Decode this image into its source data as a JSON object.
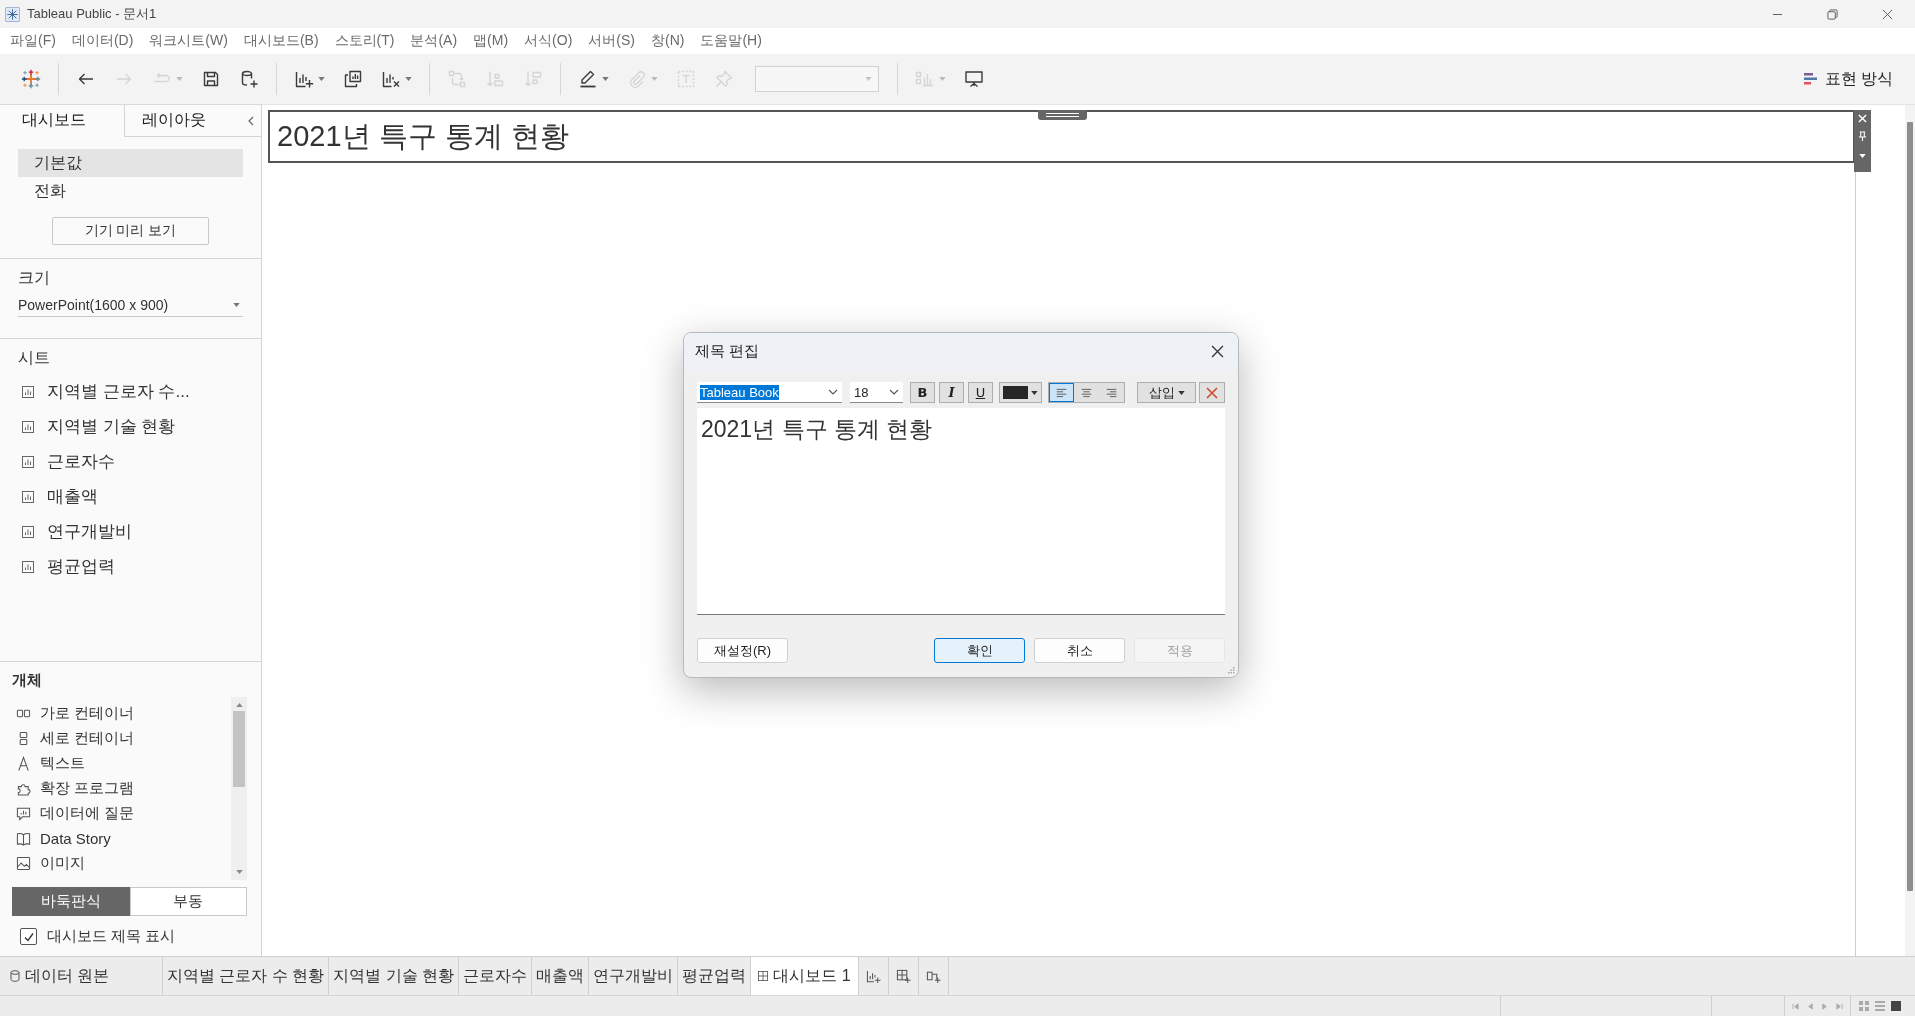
{
  "window": {
    "title": "Tableau Public - 문서1"
  },
  "menu": [
    "파일(F)",
    "데이터(D)",
    "워크시트(W)",
    "대시보드(B)",
    "스토리(T)",
    "분석(A)",
    "맵(M)",
    "서식(O)",
    "서버(S)",
    "창(N)",
    "도움말(H)"
  ],
  "toolbar": {
    "groups": [
      [
        {
          "kind": "button",
          "disabled": false,
          "menu": false
        }
      ],
      [
        {
          "kind": "button",
          "disabled": false,
          "menu": false
        },
        {
          "kind": "button",
          "disabled": true,
          "menu": false
        },
        {
          "kind": "button",
          "disabled": true,
          "menu": true
        },
        {
          "kind": "button",
          "disabled": false,
          "menu": false
        },
        {
          "kind": "button",
          "disabled": false,
          "menu": false
        }
      ],
      [
        {
          "kind": "button",
          "disabled": false,
          "menu": true
        },
        {
          "kind": "button",
          "disabled": false,
          "menu": false
        },
        {
          "kind": "button",
          "disabled": false,
          "menu": true
        }
      ],
      [
        {
          "kind": "button",
          "disabled": true,
          "menu": false
        },
        {
          "kind": "button",
          "disabled": true,
          "menu": false
        },
        {
          "kind": "button",
          "disabled": true,
          "menu": false
        }
      ],
      [
        {
          "kind": "button",
          "disabled": false,
          "menu": true
        },
        {
          "kind": "button",
          "disabled": true,
          "menu": true
        },
        {
          "kind": "button",
          "disabled": true,
          "menu": false
        },
        {
          "kind": "button",
          "disabled": true,
          "menu": false
        },
        {
          "kind": "dropdown",
          "disabled": true,
          "menu": true
        }
      ],
      [
        {
          "kind": "button",
          "disabled": true,
          "menu": true
        },
        {
          "kind": "button",
          "disabled": false,
          "menu": false
        }
      ]
    ],
    "show_me": {
      "label": "표현 방식"
    }
  },
  "sidebar": {
    "tabs": [
      {
        "label": "대시보드",
        "selected": true
      },
      {
        "label": "레이아웃",
        "selected": false
      }
    ],
    "devices": [
      {
        "label": "기본값",
        "selected": true
      },
      {
        "label": "전화",
        "selected": false
      }
    ],
    "device_preview_button": "기기 미리 보기",
    "size": {
      "label": "크기",
      "value": "PowerPoint(1600 x 900)"
    },
    "sheets": {
      "label": "시트",
      "items": [
        "지역별 근로자 수...",
        "지역별 기술 현황",
        "근로자수",
        "매출액",
        "연구개발비",
        "평균업력"
      ]
    },
    "objects": {
      "label": "개체",
      "items": [
        "가로 컨테이너",
        "세로 컨테이너",
        "텍스트",
        "확장 프로그램",
        "데이터에 질문",
        "Data Story",
        "이미지"
      ]
    },
    "layout_modes": [
      {
        "label": "바둑판식",
        "selected": true
      },
      {
        "label": "부동",
        "selected": false
      }
    ],
    "show_title": {
      "label": "대시보드 제목 표시",
      "checked": true
    }
  },
  "title_zone": {
    "text": "2021년 특구 통계 현황",
    "selected": true
  },
  "dialog": {
    "title": "제목 편집",
    "font": "Tableau Book",
    "size": "18",
    "format_buttons": [
      {
        "label": "B",
        "selected": false
      },
      {
        "label": "I",
        "selected": false
      },
      {
        "label": "U",
        "selected": false
      }
    ],
    "alignment": [
      {
        "selected": true
      },
      {
        "selected": false
      },
      {
        "selected": false
      }
    ],
    "insert_button": "삽입",
    "text": "2021년 특구 통계 현황",
    "reset_button": "재설정(R)",
    "buttons": [
      {
        "label": "확인",
        "default": true,
        "disabled": false
      },
      {
        "label": "취소",
        "default": false,
        "disabled": false
      },
      {
        "label": "적용",
        "default": false,
        "disabled": true
      }
    ]
  },
  "sheet_tabs": [
    {
      "label": "데이터 원본",
      "kind": "data-source",
      "selected": false
    },
    {
      "label": "지역별 근로자 수 현황",
      "kind": "worksheet",
      "selected": false
    },
    {
      "label": "지역별 기술 현황",
      "kind": "worksheet",
      "selected": false
    },
    {
      "label": "근로자수",
      "kind": "worksheet",
      "selected": false
    },
    {
      "label": "매출액",
      "kind": "worksheet",
      "selected": false
    },
    {
      "label": "연구개발비",
      "kind": "worksheet",
      "selected": false
    },
    {
      "label": "평균업력",
      "kind": "worksheet",
      "selected": false
    },
    {
      "label": "대시보드 1",
      "kind": "dashboard",
      "selected": true
    }
  ]
}
